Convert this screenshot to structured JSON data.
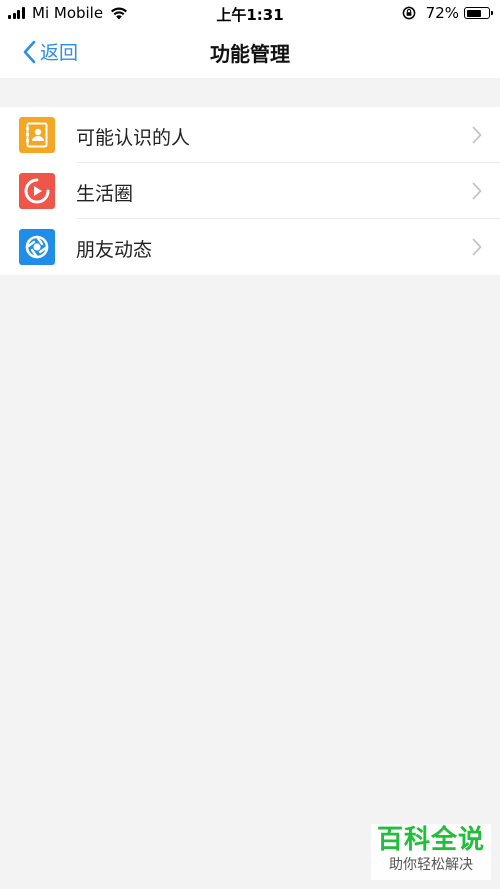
{
  "status_bar": {
    "carrier": "Mi Mobile",
    "time": "上午1:31",
    "battery_percent_label": "72%",
    "battery_level": 0.72
  },
  "nav": {
    "back_label": "返回",
    "title": "功能管理",
    "accent_color": "#2b8fe6"
  },
  "list": {
    "items": [
      {
        "label": "可能认识的人",
        "icon": "contact-card-icon",
        "icon_color": "#f5a623"
      },
      {
        "label": "生活圈",
        "icon": "play-circle-icon",
        "icon_color": "#ef5548"
      },
      {
        "label": "朋友动态",
        "icon": "aperture-icon",
        "icon_color": "#1e8ee8"
      }
    ]
  },
  "watermark": {
    "title": "百科全说",
    "subtitle": "助你轻松解决"
  }
}
